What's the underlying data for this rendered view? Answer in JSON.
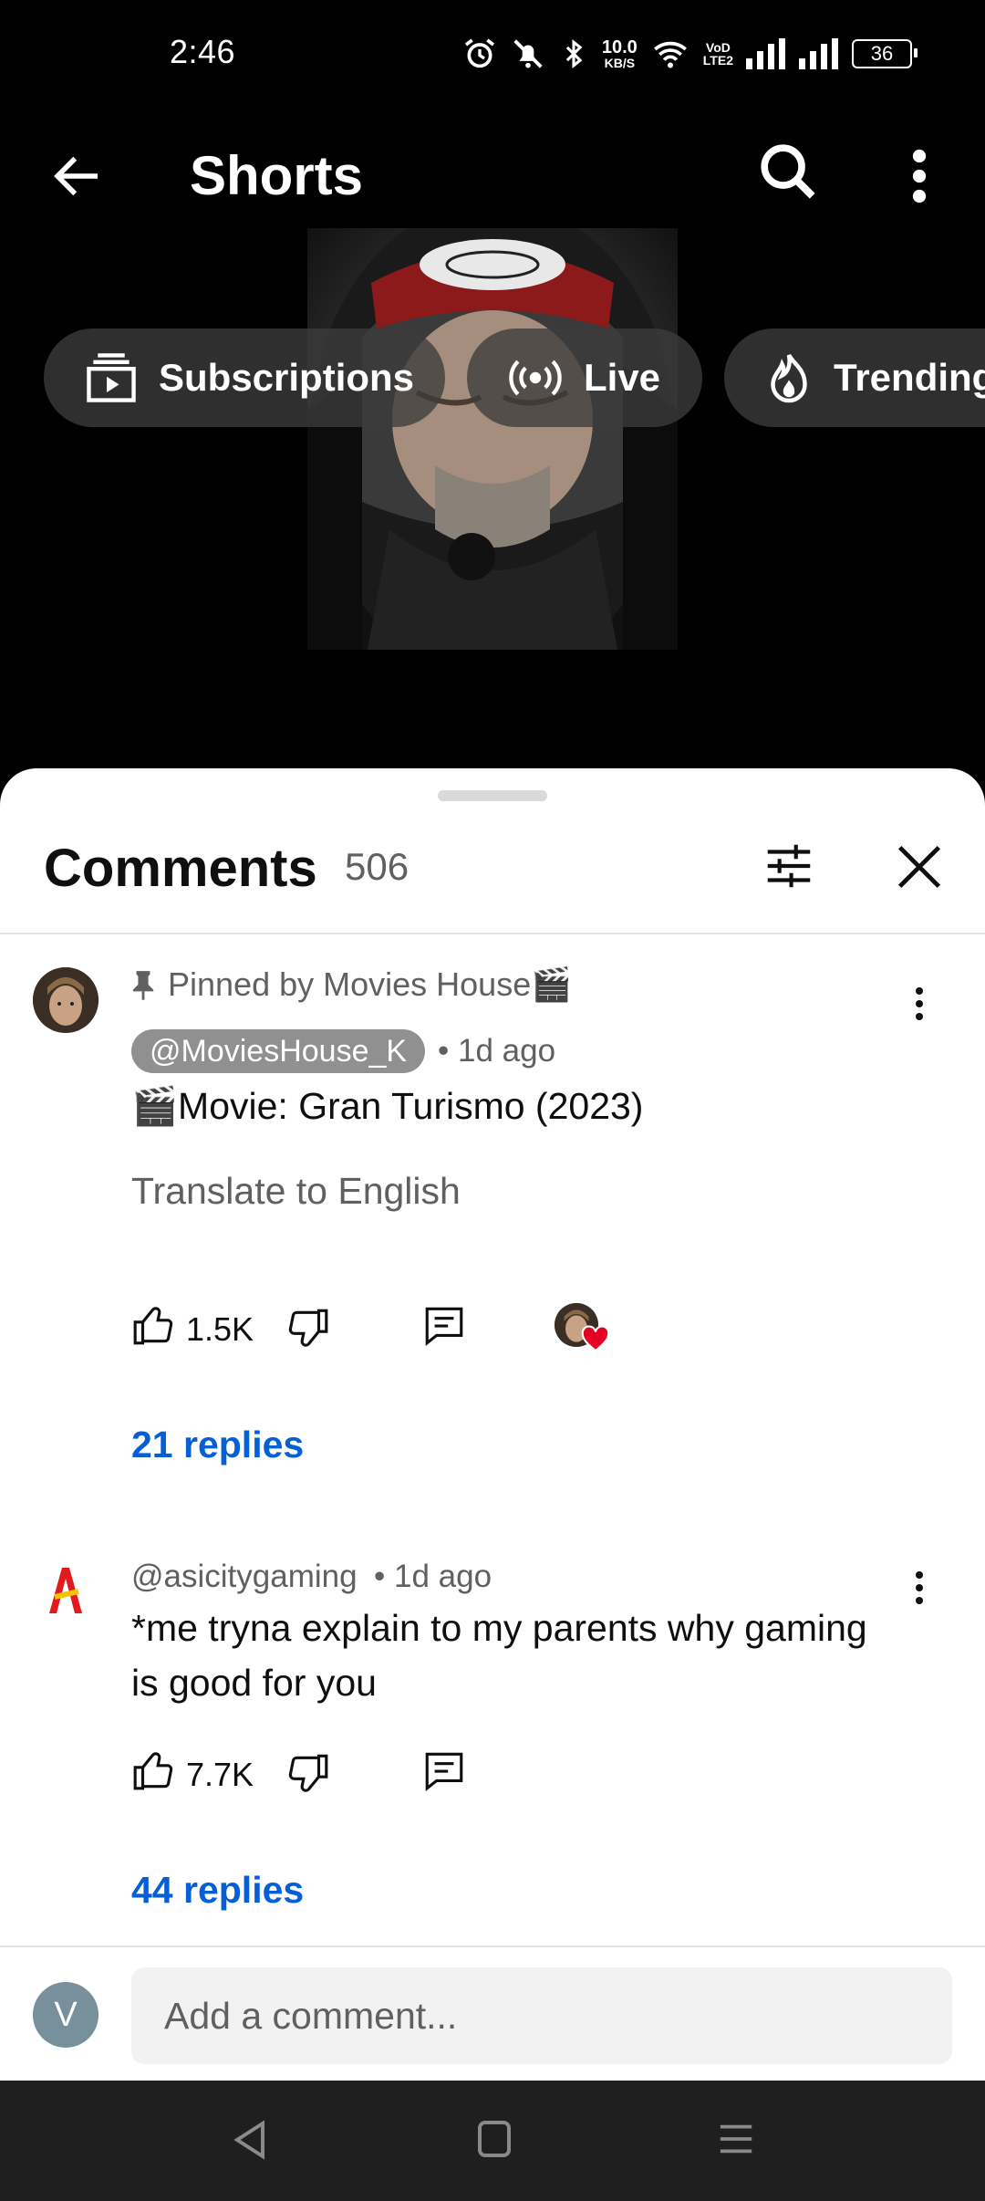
{
  "status_bar": {
    "time": "2:46",
    "net_speed_value": "10.0",
    "net_speed_unit": "KB/S",
    "volte_1": "VoD",
    "volte_2": "LTE2",
    "battery": "36"
  },
  "header": {
    "title": "Shorts",
    "back_icon": "arrow-left-icon",
    "search_icon": "search-icon",
    "more_icon": "more-vertical-icon"
  },
  "chips": [
    {
      "label": "Subscriptions",
      "icon": "subscriptions-icon"
    },
    {
      "label": "Live",
      "icon": "live-icon"
    },
    {
      "label": "Trending",
      "icon": "trending-icon"
    }
  ],
  "comments_panel": {
    "title": "Comments",
    "count": "506",
    "filter_icon": "tune-icon",
    "close_icon": "close-icon"
  },
  "comments": [
    {
      "pinned_label": "Pinned by Movies House🎬",
      "author": "@MoviesHouse_K",
      "time": "• 1d ago",
      "text": "🎬Movie: Gran Turismo  (2023)",
      "translate": "Translate to English",
      "likes": "1.5K",
      "replies": "21 replies",
      "creator_heart": true
    },
    {
      "author": "@asicitygaming",
      "time": "• 1d ago",
      "text_line1": "*me tryna explain to my parents why gaming",
      "text_line2": "is good for you",
      "likes": "7.7K",
      "replies": "44 replies"
    }
  ],
  "composer": {
    "avatar_letter": "V",
    "placeholder": "Add a comment..."
  },
  "colors": {
    "link_blue": "#065fd4",
    "secondary_text": "#606060",
    "primary_text": "#0f0f0f",
    "heart_red": "#e60023"
  }
}
